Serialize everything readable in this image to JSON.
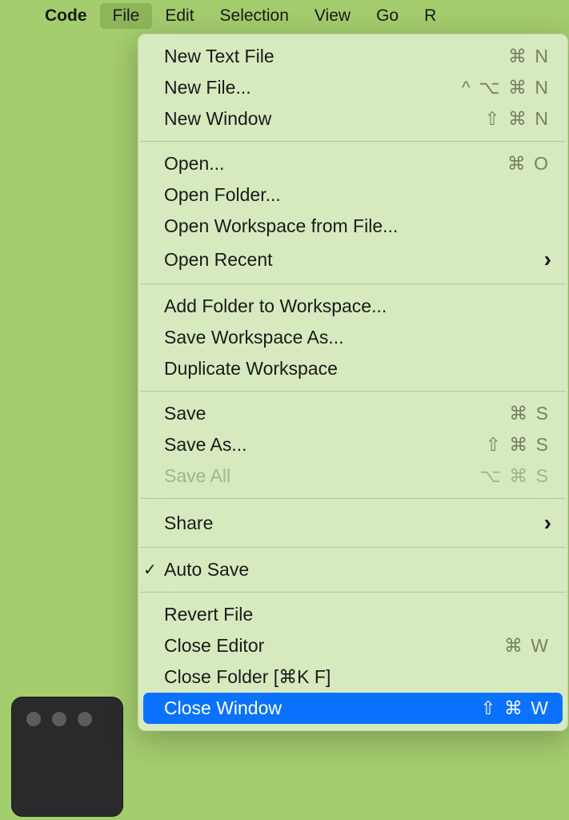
{
  "menubar": {
    "items": [
      {
        "label": "Code",
        "bold": true
      },
      {
        "label": "File",
        "active": true
      },
      {
        "label": "Edit"
      },
      {
        "label": "Selection"
      },
      {
        "label": "View"
      },
      {
        "label": "Go"
      },
      {
        "label": "R"
      }
    ]
  },
  "menu": {
    "groups": [
      [
        {
          "label": "New Text File",
          "kbd": "⌘ N"
        },
        {
          "label": "New File...",
          "kbd": "^ ⌥ ⌘ N"
        },
        {
          "label": "New Window",
          "kbd": "⇧ ⌘ N"
        }
      ],
      [
        {
          "label": "Open...",
          "kbd": "⌘ O"
        },
        {
          "label": "Open Folder..."
        },
        {
          "label": "Open Workspace from File..."
        },
        {
          "label": "Open Recent",
          "submenu": true
        }
      ],
      [
        {
          "label": "Add Folder to Workspace..."
        },
        {
          "label": "Save Workspace As..."
        },
        {
          "label": "Duplicate Workspace"
        }
      ],
      [
        {
          "label": "Save",
          "kbd": "⌘ S"
        },
        {
          "label": "Save As...",
          "kbd": "⇧ ⌘ S"
        },
        {
          "label": "Save All",
          "kbd": "⌥ ⌘ S",
          "disabled": true
        }
      ],
      [
        {
          "label": "Share",
          "submenu": true
        }
      ],
      [
        {
          "label": "Auto Save",
          "checked": true
        }
      ],
      [
        {
          "label": "Revert File"
        },
        {
          "label": "Close Editor",
          "kbd": "⌘ W"
        },
        {
          "label": "Close Folder [⌘K F]"
        },
        {
          "label": "Close Window",
          "kbd": "⇧ ⌘ W",
          "highlight": true
        }
      ]
    ]
  }
}
